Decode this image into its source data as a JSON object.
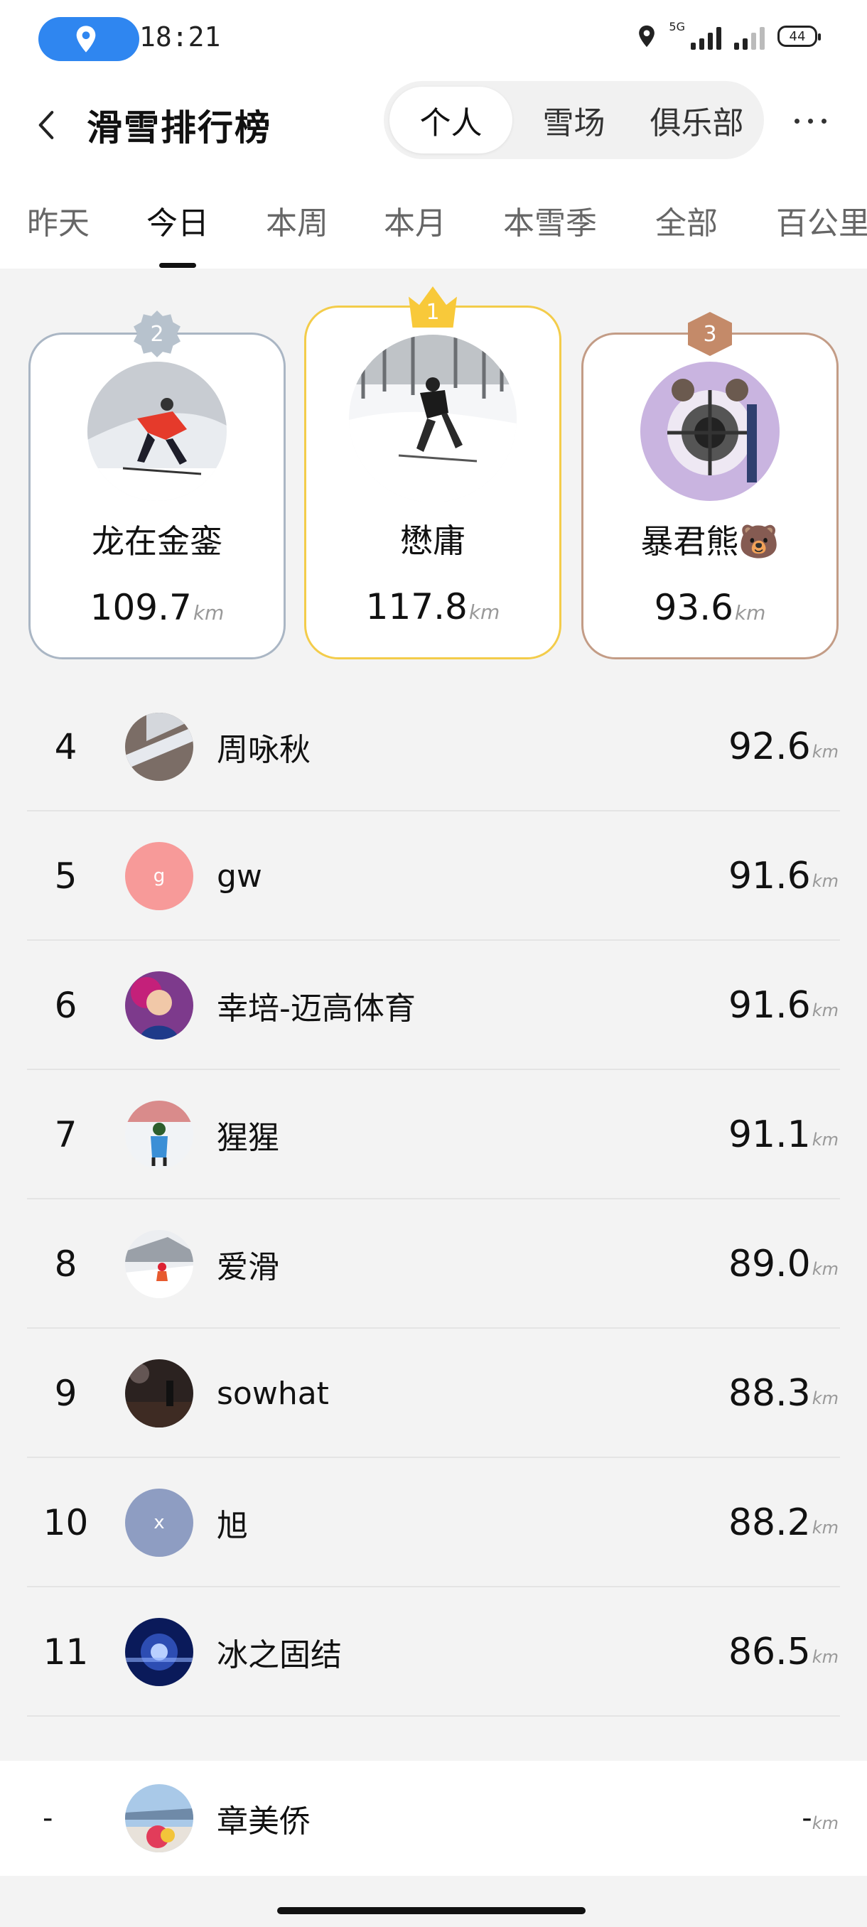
{
  "status_bar": {
    "time": "18:21",
    "network": "5G",
    "battery": "44"
  },
  "header": {
    "title": "滑雪排行榜",
    "segments": [
      {
        "label": "个人",
        "active": true
      },
      {
        "label": "雪场",
        "active": false
      },
      {
        "label": "俱乐部",
        "active": false
      }
    ]
  },
  "tabs": [
    {
      "label": "昨天",
      "active": false
    },
    {
      "label": "今日",
      "active": true
    },
    {
      "label": "本周",
      "active": false
    },
    {
      "label": "本月",
      "active": false
    },
    {
      "label": "本雪季",
      "active": false
    },
    {
      "label": "全部",
      "active": false
    },
    {
      "label": "百公里",
      "active": false
    }
  ],
  "podium": {
    "second": {
      "rank": "2",
      "name": "龙在金銮",
      "distance": "109.7",
      "unit": "km"
    },
    "first": {
      "rank": "1",
      "name": "懋庸",
      "distance": "117.8",
      "unit": "km"
    },
    "third": {
      "rank": "3",
      "name": "暴君熊🐻",
      "distance": "93.6",
      "unit": "km"
    }
  },
  "list": [
    {
      "rank": "4",
      "name": "周咏秋",
      "distance": "92.6",
      "unit": "km",
      "avatar_text": ""
    },
    {
      "rank": "5",
      "name": "gw",
      "distance": "91.6",
      "unit": "km",
      "avatar_text": "g"
    },
    {
      "rank": "6",
      "name": "幸培-迈高体育",
      "distance": "91.6",
      "unit": "km",
      "avatar_text": ""
    },
    {
      "rank": "7",
      "name": "猩猩",
      "distance": "91.1",
      "unit": "km",
      "avatar_text": ""
    },
    {
      "rank": "8",
      "name": "爱滑",
      "distance": "89.0",
      "unit": "km",
      "avatar_text": ""
    },
    {
      "rank": "9",
      "name": "sowhat",
      "distance": "88.3",
      "unit": "km",
      "avatar_text": ""
    },
    {
      "rank": "10",
      "name": "旭",
      "distance": "88.2",
      "unit": "km",
      "avatar_text": "x"
    },
    {
      "rank": "11",
      "name": "冰之固结",
      "distance": "86.5",
      "unit": "km",
      "avatar_text": ""
    }
  ],
  "my_row": {
    "rank": "-",
    "name": "章美侨",
    "distance": "-",
    "unit": "km"
  },
  "colors": {
    "accent_blue": "#2f86f0",
    "gold": "#f8c93a",
    "silver": "#b7c2cd",
    "bronze": "#c48a69",
    "avatar_gw": "#f79a99",
    "avatar_x": "#8e9dc2"
  }
}
